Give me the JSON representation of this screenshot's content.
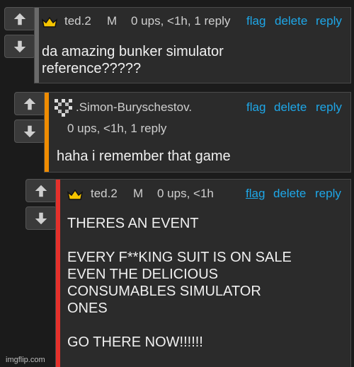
{
  "comments": [
    {
      "username": "ted.2",
      "flair": "M",
      "meta": "0 ups, <1h, 1 reply",
      "actions": {
        "flag": "flag",
        "delete": "delete",
        "reply": "reply"
      },
      "text": "da amazing bunker simulator\nreference?????",
      "accent_color": "#6a6a6a"
    },
    {
      "username": ".Simon-Buryschestov.",
      "meta": "0 ups, <1h, 1 reply",
      "actions": {
        "flag": "flag",
        "delete": "delete",
        "reply": "reply"
      },
      "text": "haha i remember that game",
      "accent_color": "#f08c00"
    },
    {
      "username": "ted.2",
      "flair": "M",
      "meta": "0 ups, <1h",
      "actions": {
        "flag": "flag",
        "delete": "delete",
        "reply": "reply"
      },
      "text": "THERES AN EVENT\n\nEVERY F**KING SUIT IS ON SALE\nEVEN THE DELICIOUS\nCONSUMABLES SIMULATOR\nONES\n\nGO THERE NOW!!!!!!",
      "accent_color": "#e5302b"
    }
  ],
  "icons": {
    "upvote": "up-arrow-icon",
    "downvote": "down-arrow-icon",
    "crown": "crown-icon",
    "avatar": "pixel-avatar-icon"
  },
  "colors": {
    "link": "#1ea7e8",
    "crown": "#f5c400"
  },
  "watermark": "imgflip.com"
}
